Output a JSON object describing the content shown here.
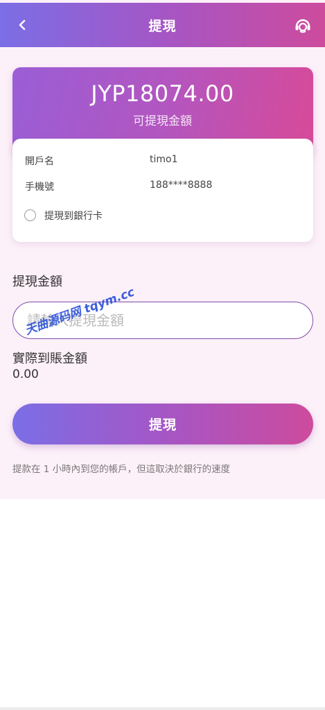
{
  "header": {
    "title": "提現",
    "back_icon": "chevron-left-icon",
    "service_icon": "customer-service-icon"
  },
  "balance": {
    "amount": "JYP18074.00",
    "label": "可提現金額"
  },
  "account": {
    "name_label": "開戶名",
    "name_value": "timo1",
    "phone_label": "手機號",
    "phone_value": "188****8888",
    "bank_option_label": "提現到銀行卡"
  },
  "withdraw": {
    "amount_label": "提現金額",
    "amount_placeholder": "請輸入提現金額",
    "actual_label": "實際到賬金額",
    "actual_value": "0.00",
    "submit_label": "提現",
    "note": "提款在 1 小時內到您的帳戶，但這取決於銀行的速度"
  },
  "watermark": "天曲源码网 tqym.cc",
  "colors": {
    "gradient_start": "#7b6ee6",
    "gradient_end": "#cd4b9d",
    "page_background": "#fdf1f9",
    "input_border": "#7d4aa8"
  }
}
